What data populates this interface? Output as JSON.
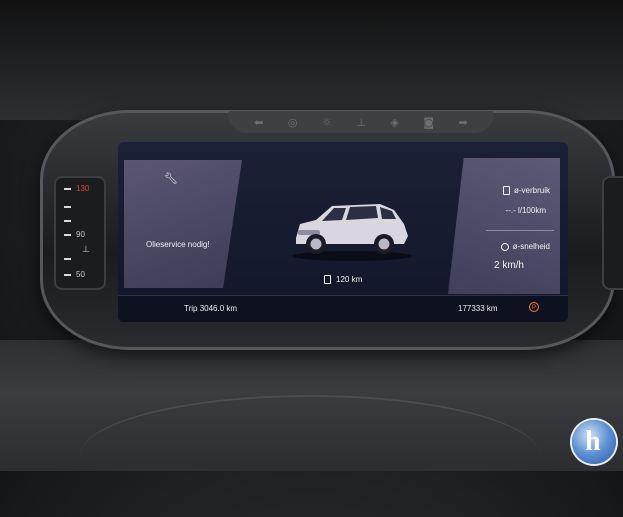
{
  "left_gauge": {
    "labels": [
      "130",
      "90",
      "50"
    ]
  },
  "left_panel": {
    "service_message": "Olieservice nodig!"
  },
  "car": {
    "range_km": "120 km"
  },
  "right_panel": {
    "consumption_title": "ø-verbruik",
    "consumption_value": "--.- l/100km",
    "speed_title": "ø-snelheid",
    "speed_value": "2 km/h"
  },
  "bottom_bar": {
    "trip": "Trip 3046.0 km",
    "odometer": "177333 km"
  },
  "colors": {
    "warning": "#ff7a1a",
    "screen_bg": "#12162a",
    "panel": "#4a4765"
  },
  "icons": [
    "wrench-icon",
    "fuel-icon",
    "speedometer-icon",
    "parking-brake-icon"
  ]
}
